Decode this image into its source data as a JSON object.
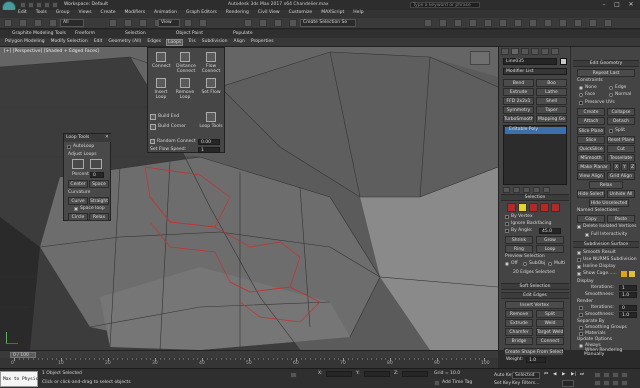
{
  "titlebar": {
    "workspace_label": "Workspace: Default",
    "title": "Autodesk 3ds Max 2017 x64    Chandelier.max",
    "search_placeholder": "Type a keyword or phrase"
  },
  "menu": [
    "Edit",
    "Tools",
    "Group",
    "Views",
    "Create",
    "Modifiers",
    "Animation",
    "Graph Editors",
    "Rendering",
    "Civil View",
    "Customize",
    "MAXScript",
    "Help"
  ],
  "toolbar": {
    "filter": "All",
    "view": "View",
    "selection_set": "Create Selection Se"
  },
  "ribbon": {
    "title": "Graphite Modeling Tools",
    "tabs": [
      "Freeform",
      "Selection",
      "Object Paint",
      "Populate"
    ],
    "subtabs": [
      "Polygon Modeling",
      "Modify Selection",
      "Edit",
      "Geometry (All)",
      "Edges",
      "Loops",
      "Tris",
      "Subdivision",
      "Align",
      "Properties"
    ]
  },
  "viewport": {
    "label": "[+] [Perspective] [Shaded + Edged Faces]"
  },
  "loops_panel": {
    "items": [
      "Connect",
      "Distance Connect",
      "Flow Connect",
      "Insert Loop",
      "Remove Loop",
      "Set Flow",
      "Build End",
      "Build Corner",
      "Loop Tools"
    ],
    "random_connect_label": "Random Connect",
    "random_connect_value": "0.00",
    "set_flow_speed_label": "Set Flow Speed:",
    "set_flow_speed_value": "1"
  },
  "loop_tools": {
    "title": "Loop Tools",
    "autoloop": "AutoLoop",
    "adjust_loops": "Adjust Loops",
    "percent_label": "Percent",
    "percent_value": "0",
    "center": "Center",
    "space": "Space",
    "curvature": "Curvature",
    "curve": "Curve",
    "straight": "Straight",
    "space_loop": "Space loop",
    "circle": "Circle",
    "relax": "Relax"
  },
  "modifier_panel": {
    "object_name": "Line035",
    "modifier_list": "Modifier List",
    "buttons": [
      "Bend",
      "Boo",
      "Extrude",
      "Lathe",
      "FFD 2x2x1",
      "Shell",
      "Symmetry",
      "Taper",
      "TurboSmooth",
      "Mapping Ge"
    ],
    "stack_item": "Editable Poly",
    "selection_title": "Selection",
    "by_vertex": "By Vertex",
    "ignore_backfacing": "Ignore Backfacing",
    "by_angle_label": "By Angle:",
    "by_angle_value": "45.0",
    "shrink": "Shrink",
    "grow": "Grow",
    "ring": "Ring",
    "loop": "Loop",
    "preview_selection": "Preview Selection",
    "off": "Off",
    "subobj": "SubObj",
    "multi": "Multi",
    "edges_selected": "20 Edges Selected",
    "soft_selection": "Soft Selection",
    "edit_edges": "Edit Edges",
    "insert_vertex": "Insert Vertex",
    "remove": "Remove",
    "split": "Split",
    "extrude": "Extrude",
    "weld": "Weld",
    "chamfer": "Chamfer",
    "target_weld": "Target Weld",
    "bridge": "Bridge",
    "connect": "Connect",
    "create_shape": "Create Shape From Selection",
    "weight_label": "Weight:",
    "weight_value": "1.0"
  },
  "right_panel": {
    "edit_geometry": "Edit Geometry",
    "repeat_last": "Repeat Last",
    "constraints": "Constraints",
    "none": "None",
    "edge": "Edge",
    "face": "Face",
    "normal": "Normal",
    "preserve_uvs": "Preserve UVs",
    "create": "Create",
    "collapse": "Collapse",
    "attach": "Attach",
    "detach": "Detach",
    "slice_plane": "Slice Plane",
    "split": "Split",
    "slice": "Slice",
    "reset_plane": "Reset Plane",
    "quickslice": "QuickSlice",
    "cut": "Cut",
    "msmooth": "MSmooth",
    "tessellate": "Tessellate",
    "make_planar": "Make Planar",
    "x": "X",
    "y": "Y",
    "z": "Z",
    "view_align": "View Align",
    "grid_align": "Grid Align",
    "relax": "Relax",
    "hide_selected": "Hide Selected",
    "unhide_all": "Unhide All",
    "hide_unselected": "Hide Unselected",
    "named_selections": "Named Selections:",
    "copy": "Copy",
    "paste": "Paste",
    "delete_isolated": "Delete Isolated Vertices",
    "full_interactivity": "Full Interactivity",
    "subdivision_surface": "Subdivision Surface",
    "smooth_result": "Smooth Result",
    "use_nurms": "Use NURMS Subdivision",
    "isoline_display": "Isoline Display",
    "show_cage": "Show Cage......",
    "display": "Display",
    "iterations_label": "Iterations:",
    "iterations_value": "1",
    "smoothness_label": "Smoothness:",
    "smoothness_value": "1.0",
    "render": "Render",
    "render_iterations_value": "0",
    "render_smoothness_value": "1.0",
    "separate_by": "Separate By",
    "smoothing_groups": "Smoothing Groups",
    "materials": "Materials",
    "update_options": "Update Options",
    "always": "Always",
    "when_rendering": "When Rendering",
    "manually": "Manually"
  },
  "timeline": {
    "frame": "0 / 100",
    "ticks": [
      "0",
      "10",
      "20",
      "30",
      "40",
      "50",
      "60",
      "70",
      "80",
      "90",
      "100"
    ]
  },
  "statusbar": {
    "maxscript": "Max to Physic",
    "objects_selected": "1 Object Selected",
    "prompt": "Click or click-and-drag to select objects",
    "x_label": "X:",
    "y_label": "Y:",
    "z_label": "Z:",
    "grid": "Grid = 10.0",
    "auto_key": "Auto Key",
    "selected": "Selected",
    "set_key": "Set Key",
    "key_filters": "Key Filters...",
    "add_time_tag": "Add Time Tag"
  }
}
